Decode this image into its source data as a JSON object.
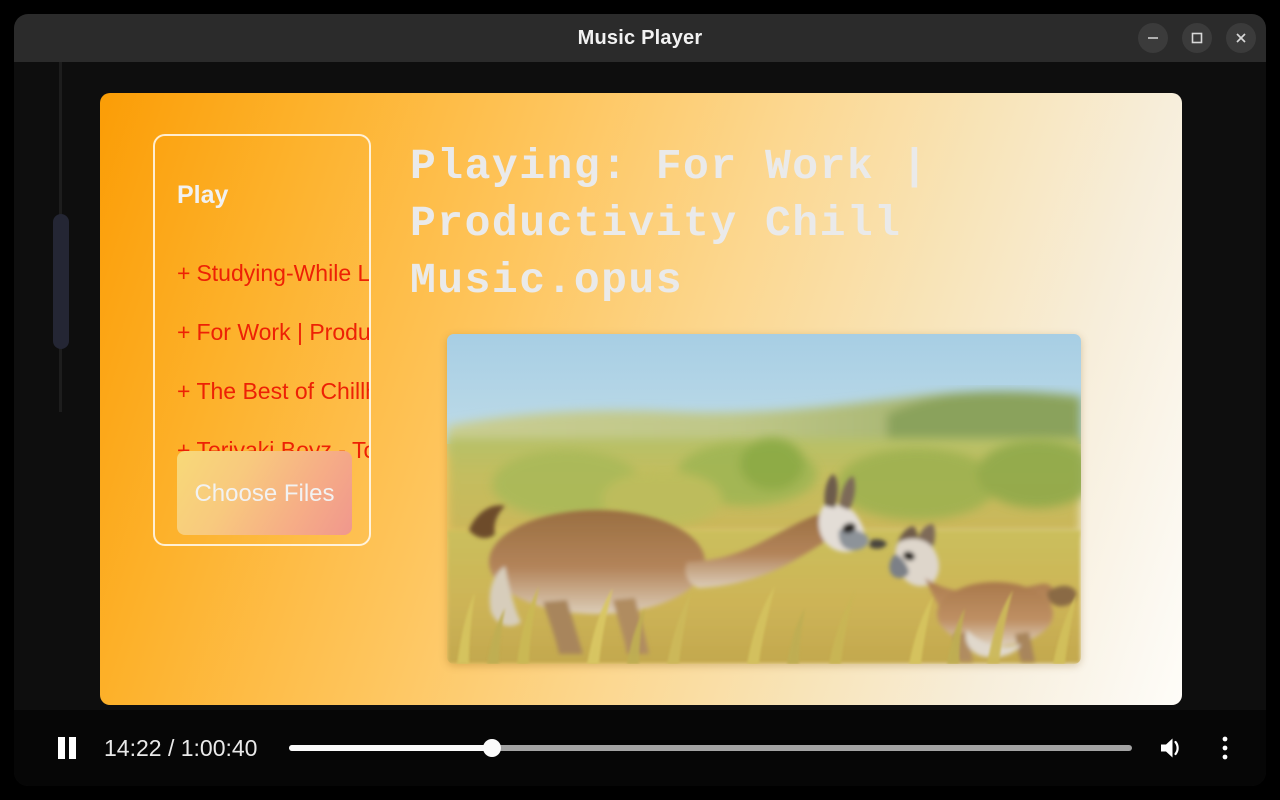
{
  "window": {
    "title": "Music Player",
    "buttons": {
      "minimize": "minimize-icon",
      "maximize": "maximize-icon",
      "close": "close-icon"
    }
  },
  "playlist": {
    "heading": "Play",
    "items": [
      {
        "prefix": "+",
        "label": "Studying-While Listening To Lofi Beats"
      },
      {
        "prefix": "+",
        "label": "For Work  |  Productivity Chill Music"
      },
      {
        "prefix": "+",
        "label": "The Best of Chillhop Essentials"
      },
      {
        "prefix": "+",
        "label": "Teriyaki Boyz - Tokyo Drift"
      }
    ],
    "choose_files_label": "Choose Files"
  },
  "now_playing": {
    "text": "Playing: For Work | Productivity Chill Music.opus"
  },
  "artwork": {
    "alt": "Two guanacos standing nose to nose in a sunlit grassland under a blue sky"
  },
  "controls": {
    "play_pause_state": "pause-icon",
    "current_time": "14:22",
    "total_time": "1:00:40",
    "time_display": "14:22 / 1:00:40",
    "progress_percent": 24,
    "volume_icon": "volume-on-icon",
    "menu_icon": "more-vertical-icon"
  },
  "colors": {
    "accent_orange": "#fb9d06",
    "panel_end": "#fffdf8",
    "playlist_text": "#ed2105",
    "titlebar": "#2b2b2b",
    "controls_bar": "#060606"
  }
}
